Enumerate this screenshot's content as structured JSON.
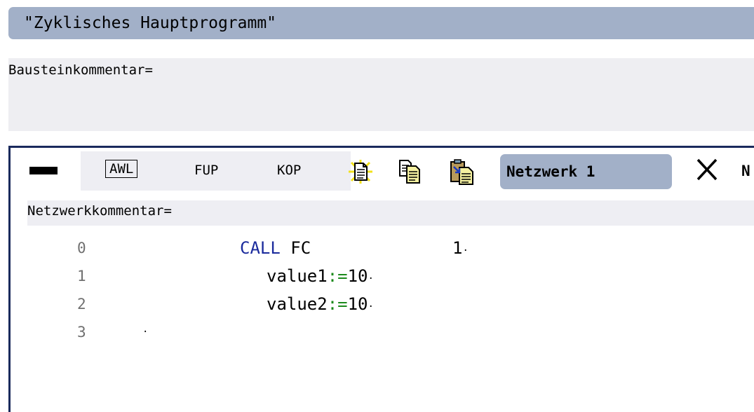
{
  "block": {
    "title": "\"Zyklisches Hauptprogramm\"",
    "comment_label": "Bausteinkommentar="
  },
  "toolbar": {
    "collapse_icon": "minus-bar-icon",
    "awl_label": "AWL",
    "fup_label": "FUP",
    "kop_label": "KOP",
    "icons": [
      "new-network-icon",
      "copy-icon",
      "paste-icon",
      "close-icon"
    ],
    "network_title": "Netzwerk 1",
    "next_label_cut": "N"
  },
  "network": {
    "comment_label": "Netzwerkkommentar=",
    "lines": [
      {
        "no": "0",
        "keyword": "CALL",
        "text": " FC",
        "param": "1",
        "trail": "·"
      },
      {
        "no": "1",
        "name": "value1",
        "op": ":=",
        "value": "10",
        "trail": "·"
      },
      {
        "no": "2",
        "name": "value2",
        "op": ":=",
        "value": "10",
        "trail": "·"
      },
      {
        "no": "3",
        "trail": "·"
      }
    ]
  },
  "colors": {
    "title_bar": "#a2b0c8",
    "keyword": "#1a2a9c",
    "operator": "#1c8a1c",
    "network_border": "#1a2a5c"
  }
}
